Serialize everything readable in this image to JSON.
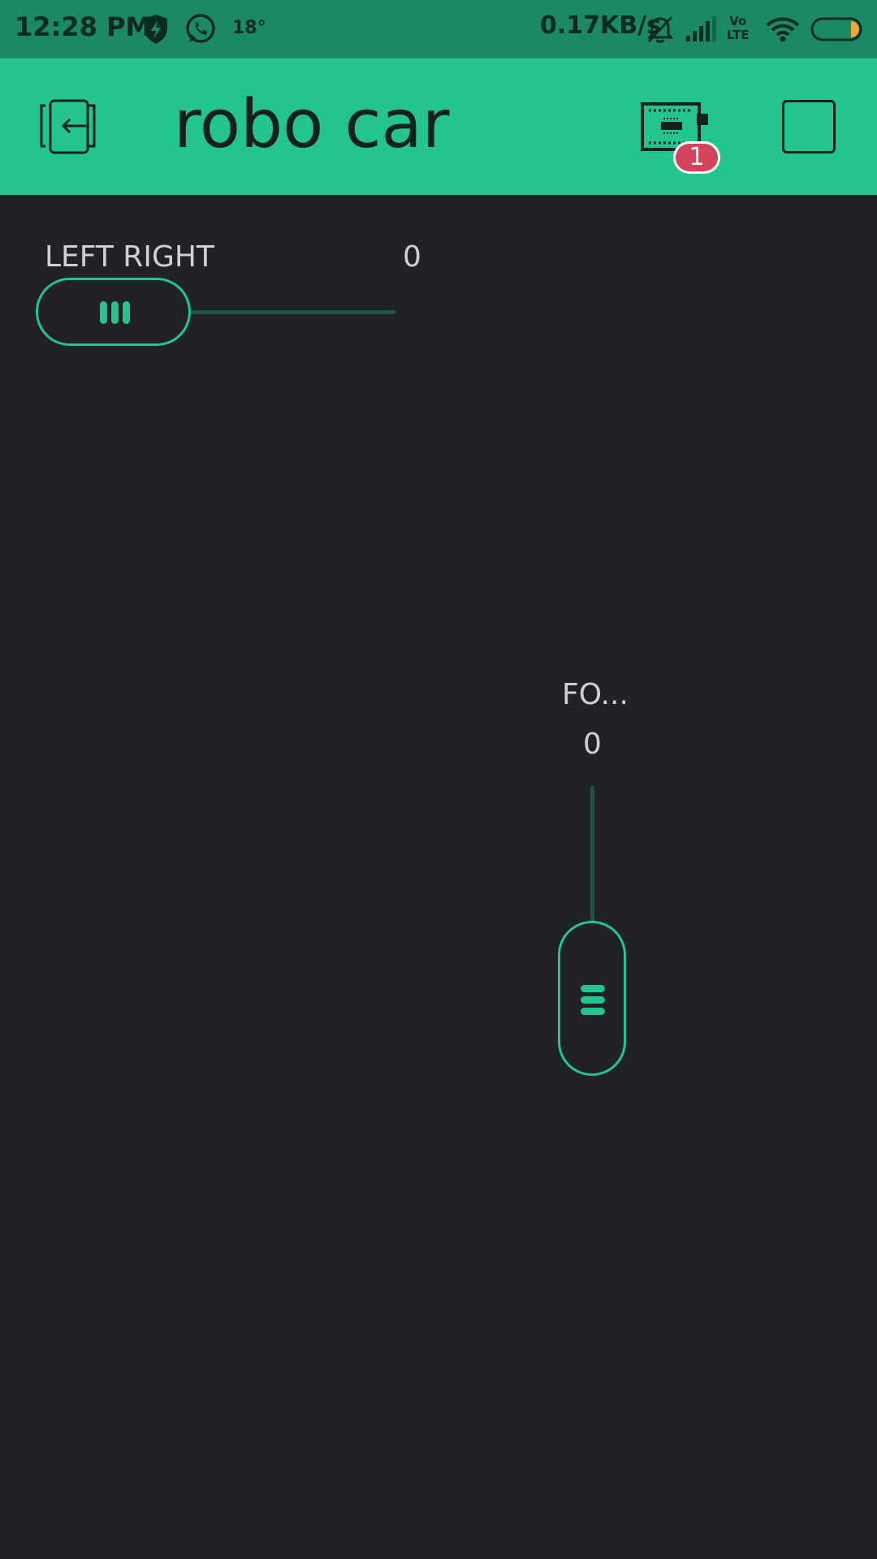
{
  "status_bar": {
    "time": "12:28 PM",
    "temperature": "18°",
    "network_speed": "0.17KB/s",
    "volte_top": "Vo",
    "volte_bottom": "LTE",
    "battery_level": 0.2,
    "icons": [
      "shield-bolt-icon",
      "whatsapp-icon",
      "mute-bell-icon",
      "signal-icon",
      "volte-icon",
      "wifi-icon",
      "battery-icon"
    ]
  },
  "app_bar": {
    "title": "robo car",
    "device_badge": "1",
    "icons": [
      "exit-icon",
      "device-board-icon",
      "stop-icon"
    ]
  },
  "sliders": {
    "left_right": {
      "label": "LEFT RIGHT",
      "value": "0"
    },
    "forward": {
      "label": "FO...",
      "value": "0"
    }
  },
  "colors": {
    "accent": "#23c48e",
    "status_bar": "#1b8a64",
    "background": "#212226",
    "track": "#1e5545",
    "badge": "#d3435c",
    "text": "#cfd1d3"
  }
}
